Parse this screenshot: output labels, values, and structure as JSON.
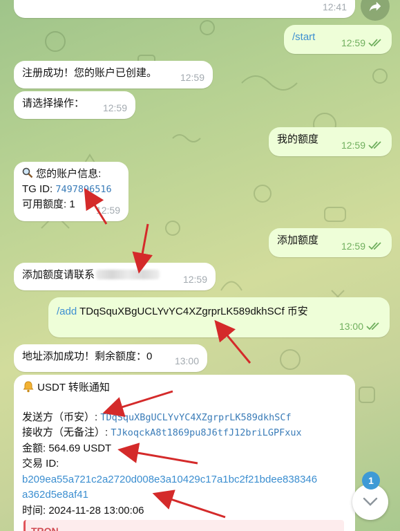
{
  "messages": {
    "m0_time": "12:41",
    "m1_cmd": "/start",
    "m1_time": "12:59",
    "m2_text": "注册成功！您的账户已创建。",
    "m2_time": "12:59",
    "m3_text": "请选择操作：",
    "m3_time": "12:59",
    "m4_text": "我的额度",
    "m4_time": "12:59",
    "m5_line1": "您的账户信息:",
    "m5_tg_label": "TG ID: ",
    "m5_tg_value": "7497896516",
    "m5_line3": "可用额度: 1",
    "m5_time": "12:59",
    "m6_text": "添加额度",
    "m6_time": "12:59",
    "m7_text": "添加额度请联系",
    "m7_time": "12:59",
    "m8_cmd": "/add",
    "m8_text": " TDqSquXBgUCLYvYC4XZgrprLK589dkhSCf 币安",
    "m8_time": "13:00",
    "m9_text": "地址添加成功！剩余额度：0",
    "m9_time": "13:00",
    "m10_title": "USDT 转账通知",
    "m10_sender_label": "发送方（币安）: ",
    "m10_sender_value": "TDqSquXBgUCLYvYC4XZgrprLK589dkhSCf",
    "m10_receiver_label": "接收方（无备注）: ",
    "m10_receiver_value": "TJkoqckA8t1869pu8J6tfJ12briLGPFxux",
    "m10_amount": "金额: 564.69 USDT",
    "m10_txid_label": "交易 ID:",
    "m10_txid_1": "b209ea55a721c2a2720d008e3a10429c17a1bc2f21bdee838346",
    "m10_txid_2": "a362d5e8af41",
    "m10_time_line": "时间: 2024-11-28 13:00:06",
    "m10_quote": "TRON"
  },
  "unread_count": "1",
  "icons": {
    "magnifier": "magnifier-icon",
    "bell": "bell-icon",
    "read_check": "double-check-icon",
    "scroll_down": "chevron-down-icon",
    "share": "share-arrow-icon"
  },
  "colors": {
    "outgoing_bubble": "#eefed8",
    "incoming_bubble": "#ffffff",
    "link": "#3b8ed0",
    "check": "#6fae5d",
    "annotation_arrow": "#d42a2a"
  }
}
